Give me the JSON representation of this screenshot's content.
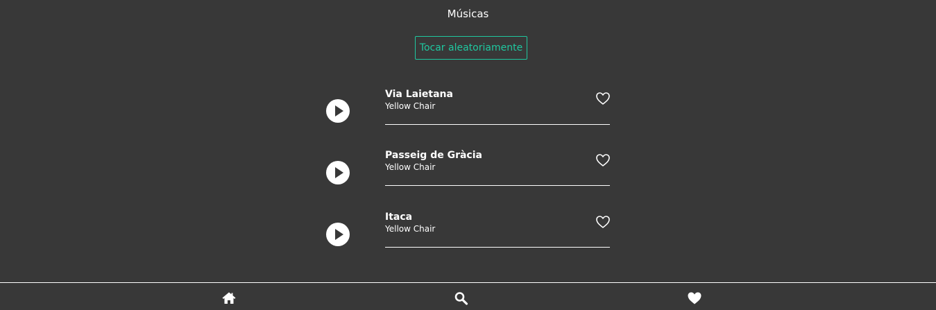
{
  "header": {
    "title": "Músicas",
    "shuffle_label": "Tocar aleatoriamente"
  },
  "songs": [
    {
      "title": "Via Laietana",
      "artist": "Yellow Chair",
      "favorite": false
    },
    {
      "title": "Passeig de Gràcia",
      "artist": "Yellow Chair",
      "favorite": false
    },
    {
      "title": "Itaca",
      "artist": "Yellow Chair",
      "favorite": false
    }
  ],
  "icons": {
    "play": "play-icon",
    "favorite": "heart-outline-icon",
    "nav_home": "home-icon",
    "nav_search": "search-icon",
    "nav_favorites": "heart-icon"
  },
  "colors": {
    "background": "#383838",
    "accent": "#1fc8a0",
    "foreground": "#ffffff"
  }
}
